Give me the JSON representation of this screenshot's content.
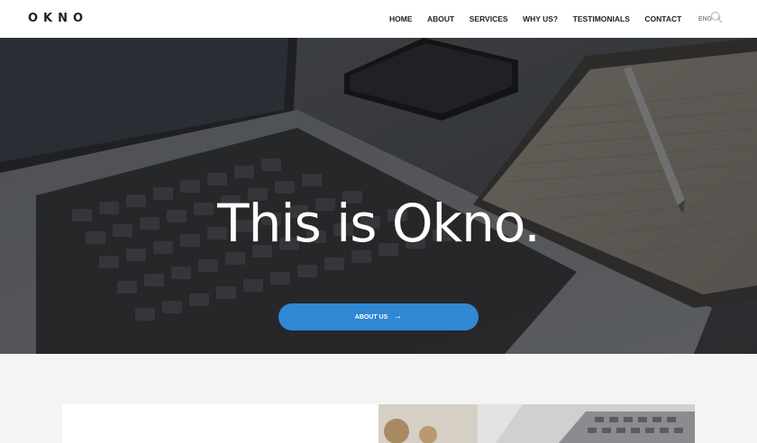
{
  "header": {
    "logo": "OKNO",
    "nav": [
      "HOME",
      "ABOUT",
      "SERVICES",
      "WHY US?",
      "TESTIMONIALS",
      "CONTACT"
    ],
    "language": "ENG",
    "icons": {
      "search": "search-icon",
      "lang_caret": "chevron-down-icon"
    }
  },
  "hero": {
    "title": "This is Okno.",
    "button_label": "ABOUT US",
    "button_color": "#3088d4"
  }
}
